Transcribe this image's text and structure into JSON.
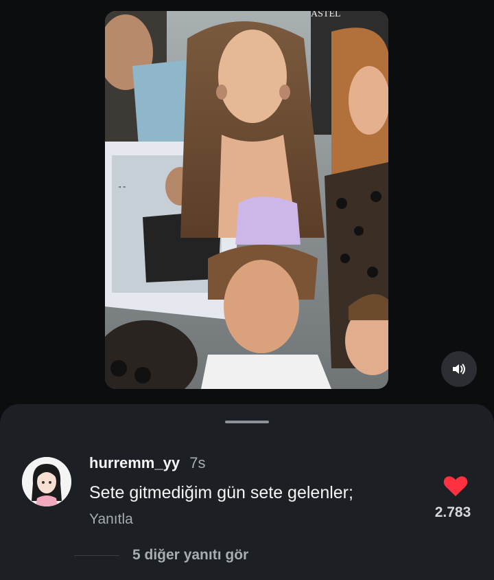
{
  "video": {
    "image_description": "Group photo of fans at a film set; a girl in a lavender halter top, a boy in front, a woman with a leopard print top and a printed pillow with a young man's photo",
    "watermark": "ASTEL"
  },
  "sound_button": {
    "icon": "speaker-icon"
  },
  "comment": {
    "username": "hurremm_yy",
    "time": "7s",
    "text": "Sete gitmediğim gün sete gelenler;",
    "reply_label": "Yanıtla",
    "like_count": "2.783",
    "like_color": "#ff3040",
    "view_replies": "5 diğer yanıtı gör"
  },
  "colors": {
    "sheet_background": "#1c1f23",
    "page_background": "#0b0d0f",
    "muted_text": "#a8adb3"
  }
}
